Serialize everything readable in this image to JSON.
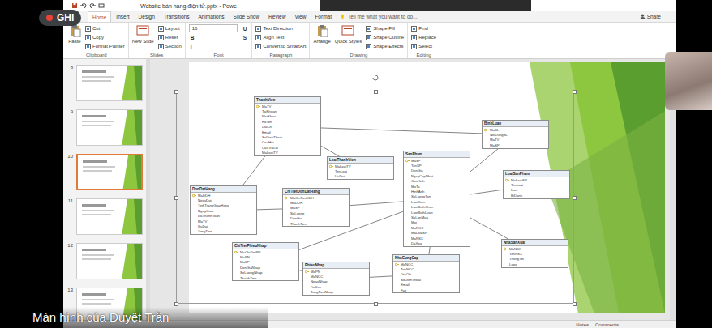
{
  "window": {
    "title": "Website bán hàng điện tử.pptx - Powe"
  },
  "recording": {
    "label": "GHI"
  },
  "tabs": [
    {
      "label": "Home",
      "selected": true
    },
    {
      "label": "Insert",
      "selected": false
    },
    {
      "label": "Design",
      "selected": false
    },
    {
      "label": "Transitions",
      "selected": false
    },
    {
      "label": "Animations",
      "selected": false
    },
    {
      "label": "Slide Show",
      "selected": false
    },
    {
      "label": "Review",
      "selected": false
    },
    {
      "label": "View",
      "selected": false
    },
    {
      "label": "Format",
      "selected": false
    }
  ],
  "tell_me": {
    "placeholder": "Tell me what you want to do..."
  },
  "share": "Share",
  "ribbon": {
    "groups": [
      {
        "label": "Clipboard",
        "items": [
          {
            "text": "Paste",
            "kind": "big"
          },
          {
            "text": "Cut",
            "kind": "small"
          },
          {
            "text": "Copy",
            "kind": "small"
          },
          {
            "text": "Format Painter",
            "kind": "small"
          }
        ]
      },
      {
        "label": "Slides",
        "items": [
          {
            "text": "New Slide",
            "kind": "big"
          },
          {
            "text": "Layout",
            "kind": "small"
          },
          {
            "text": "Reset",
            "kind": "small"
          },
          {
            "text": "Section",
            "kind": "small"
          }
        ]
      },
      {
        "label": "Font",
        "items": [
          {
            "text": "16",
            "kind": "field"
          },
          {
            "text": "B",
            "kind": "glyph"
          },
          {
            "text": "I",
            "kind": "glyph"
          },
          {
            "text": "U",
            "kind": "glyph"
          },
          {
            "text": "S",
            "kind": "glyph"
          }
        ]
      },
      {
        "label": "Paragraph",
        "items": [
          {
            "text": "Text Direction",
            "kind": "small"
          },
          {
            "text": "Align Text",
            "kind": "small"
          },
          {
            "text": "Convert to SmartArt",
            "kind": "small"
          }
        ]
      },
      {
        "label": "Drawing",
        "items": [
          {
            "text": "Arrange",
            "kind": "big"
          },
          {
            "text": "Quick Styles",
            "kind": "big"
          },
          {
            "text": "Shape Fill",
            "kind": "small"
          },
          {
            "text": "Shape Outline",
            "kind": "small"
          },
          {
            "text": "Shape Effects",
            "kind": "small"
          }
        ]
      },
      {
        "label": "Editing",
        "items": [
          {
            "text": "Find",
            "kind": "small"
          },
          {
            "text": "Replace",
            "kind": "small"
          },
          {
            "text": "Select",
            "kind": "small"
          }
        ]
      }
    ]
  },
  "slides": [
    {
      "number": "8",
      "selected": false
    },
    {
      "number": "9",
      "selected": false
    },
    {
      "number": "10",
      "selected": true
    },
    {
      "number": "11",
      "selected": false
    },
    {
      "number": "12",
      "selected": false
    },
    {
      "number": "13",
      "selected": false
    }
  ],
  "entities": [
    {
      "name": "ThanhVien",
      "fields": [
        {
          "name": "MaTV",
          "key": true
        },
        {
          "name": "TaiKhoan",
          "key": false
        },
        {
          "name": "MatKhau",
          "key": false
        },
        {
          "name": "HoTen",
          "key": false
        },
        {
          "name": "DiaChi",
          "key": false
        },
        {
          "name": "Email",
          "key": false
        },
        {
          "name": "SoDienThoai",
          "key": false
        },
        {
          "name": "CauHoi",
          "key": false
        },
        {
          "name": "CauTraLoi",
          "key": false
        },
        {
          "name": "MaLoaiTV",
          "key": false
        }
      ]
    },
    {
      "name": "BinhLuan",
      "fields": [
        {
          "name": "MaBL",
          "key": true
        },
        {
          "name": "NoiDungBL",
          "key": false
        },
        {
          "name": "MaTV",
          "key": false
        },
        {
          "name": "MaSP",
          "key": false
        }
      ]
    },
    {
      "name": "LoaiThanhVien",
      "fields": [
        {
          "name": "MaLoaiTV",
          "key": true
        },
        {
          "name": "TenLoai",
          "key": false
        },
        {
          "name": "UuDai",
          "key": false
        }
      ]
    },
    {
      "name": "SanPham",
      "fields": [
        {
          "name": "MaSP",
          "key": true
        },
        {
          "name": "TenSP",
          "key": false
        },
        {
          "name": "DonGia",
          "key": false
        },
        {
          "name": "NgayCapNhat",
          "key": false
        },
        {
          "name": "CauHinh",
          "key": false
        },
        {
          "name": "MoTa",
          "key": false
        },
        {
          "name": "HinhAnh",
          "key": false
        },
        {
          "name": "SoLuongTon",
          "key": false
        },
        {
          "name": "LuotXem",
          "key": false
        },
        {
          "name": "LuotBinhChon",
          "key": false
        },
        {
          "name": "LuotBinhLuan",
          "key": false
        },
        {
          "name": "SoLanMua",
          "key": false
        },
        {
          "name": "Moi",
          "key": false
        },
        {
          "name": "MaNCC",
          "key": false
        },
        {
          "name": "MaLoaiSP",
          "key": false
        },
        {
          "name": "MaNSX",
          "key": false
        },
        {
          "name": "DaXoa",
          "key": false
        }
      ]
    },
    {
      "name": "LoaiSanPham",
      "fields": [
        {
          "name": "MaLoaiSP",
          "key": true
        },
        {
          "name": "TenLoai",
          "key": false
        },
        {
          "name": "Icon",
          "key": false
        },
        {
          "name": "BiDanh",
          "key": false
        }
      ]
    },
    {
      "name": "NhaSanXuat",
      "fields": [
        {
          "name": "MaNSX",
          "key": true
        },
        {
          "name": "TenNSX",
          "key": false
        },
        {
          "name": "ThongTin",
          "key": false
        },
        {
          "name": "Logo",
          "key": false
        }
      ]
    },
    {
      "name": "DonDatHang",
      "fields": [
        {
          "name": "MaDDH",
          "key": true
        },
        {
          "name": "NgayDat",
          "key": false
        },
        {
          "name": "TinhTrangGiaoHang",
          "key": false
        },
        {
          "name": "NgayGiao",
          "key": false
        },
        {
          "name": "DaThanhToan",
          "key": false
        },
        {
          "name": "MaTV",
          "key": false
        },
        {
          "name": "UuDai",
          "key": false
        },
        {
          "name": "TongTien",
          "key": false
        }
      ]
    },
    {
      "name": "ChiTietDonDatHang",
      "fields": [
        {
          "name": "MaChiTietDDH",
          "key": true
        },
        {
          "name": "MaDDH",
          "key": false
        },
        {
          "name": "MaSP",
          "key": false
        },
        {
          "name": "SoLuong",
          "key": false
        },
        {
          "name": "DonGia",
          "key": false
        },
        {
          "name": "ThanhTien",
          "key": false
        }
      ]
    },
    {
      "name": "ChiTietPhieuNhap",
      "fields": [
        {
          "name": "MaChiTietPN",
          "key": true
        },
        {
          "name": "MaPN",
          "key": false
        },
        {
          "name": "MaSP",
          "key": false
        },
        {
          "name": "DonGiaNhap",
          "key": false
        },
        {
          "name": "SoLuongNhap",
          "key": false
        },
        {
          "name": "ThanhTien",
          "key": false
        }
      ]
    },
    {
      "name": "PhieuNhap",
      "fields": [
        {
          "name": "MaPN",
          "key": true
        },
        {
          "name": "MaNCC",
          "key": false
        },
        {
          "name": "NgayNhap",
          "key": false
        },
        {
          "name": "DaXoa",
          "key": false
        },
        {
          "name": "TongTienNhap",
          "key": false
        }
      ]
    },
    {
      "name": "NhaCungCap",
      "fields": [
        {
          "name": "MaNCC",
          "key": true
        },
        {
          "name": "TenNCC",
          "key": false
        },
        {
          "name": "DiaChi",
          "key": false
        },
        {
          "name": "SoDienThoai",
          "key": false
        },
        {
          "name": "Email",
          "key": false
        },
        {
          "name": "Fax",
          "key": false
        }
      ]
    }
  ],
  "relations": [
    [
      "ThanhVien",
      "BinhLuan"
    ],
    [
      "ThanhVien",
      "LoaiThanhVien"
    ],
    [
      "ThanhVien",
      "DonDatHang"
    ],
    [
      "BinhLuan",
      "SanPham"
    ],
    [
      "SanPham",
      "LoaiSanPham"
    ],
    [
      "SanPham",
      "NhaSanXuat"
    ],
    [
      "SanPham",
      "ChiTietDonDatHang"
    ],
    [
      "DonDatHang",
      "ChiTietDonDatHang"
    ],
    [
      "SanPham",
      "ChiTietPhieuNhap"
    ],
    [
      "ChiTietPhieuNhap",
      "PhieuNhap"
    ],
    [
      "PhieuNhap",
      "NhaCungCap"
    ],
    [
      "NhaCungCap",
      "SanPham"
    ]
  ],
  "status_bar": {
    "items": [
      "Notes",
      "Comments"
    ]
  },
  "presenter_caption": "Màn hình của Duyệt Trần"
}
